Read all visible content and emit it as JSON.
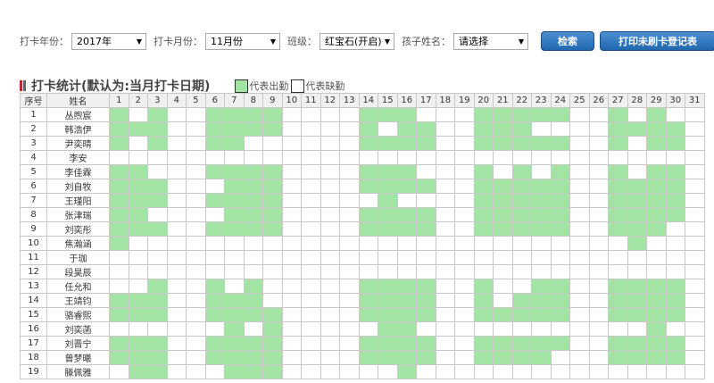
{
  "filters": {
    "year_label": "打卡年份：",
    "year_value": "2017年",
    "month_label": "打卡月份：",
    "month_value": "11月份",
    "class_label": "班级：",
    "class_value": "红宝石(开启)",
    "child_label": "孩子姓名：",
    "child_value": "请选择",
    "search_button": "检索",
    "print_button": "打印未刷卡登记表"
  },
  "section": {
    "title": "打卡统计(默认为:当月打卡日期)",
    "legend_present": "代表出勤",
    "legend_absent": "代表缺勤"
  },
  "colors": {
    "present": "#a3e4a5",
    "button": "#2a6fb5"
  },
  "table": {
    "header_index": "序号",
    "header_name": "姓名",
    "days": [
      "1",
      "2",
      "3",
      "4",
      "5",
      "6",
      "7",
      "8",
      "9",
      "10",
      "11",
      "12",
      "13",
      "14",
      "15",
      "16",
      "17",
      "18",
      "19",
      "20",
      "21",
      "22",
      "23",
      "24",
      "25",
      "26",
      "27",
      "28",
      "29",
      "30",
      "31"
    ],
    "rows": [
      {
        "index": "1",
        "name": "丛煦宸",
        "present": [
          1,
          3,
          6,
          7,
          8,
          9,
          14,
          15,
          16,
          20,
          21,
          22,
          23,
          24,
          27,
          29
        ]
      },
      {
        "index": "2",
        "name": "韩浩伊",
        "present": [
          1,
          2,
          3,
          6,
          7,
          8,
          9,
          14,
          16,
          17,
          20,
          21,
          22,
          27,
          28,
          29,
          30
        ]
      },
      {
        "index": "3",
        "name": "尹奕晴",
        "present": [
          1,
          3,
          6,
          7,
          14,
          15,
          16,
          17,
          20,
          21,
          22,
          23,
          24,
          27,
          29,
          30
        ]
      },
      {
        "index": "4",
        "name": "李安",
        "present": []
      },
      {
        "index": "5",
        "name": "李佳霖",
        "present": [
          1,
          2,
          6,
          7,
          8,
          9,
          14,
          15,
          16,
          20,
          22,
          24,
          27,
          29,
          30
        ]
      },
      {
        "index": "6",
        "name": "刘自牧",
        "present": [
          1,
          2,
          3,
          7,
          8,
          9,
          14,
          15,
          16,
          17,
          20,
          21,
          22,
          23,
          24,
          27,
          28,
          29,
          30
        ]
      },
      {
        "index": "7",
        "name": "王瑾阳",
        "present": [
          1,
          2,
          3,
          6,
          7,
          8,
          9,
          15,
          20,
          21,
          22,
          23,
          24,
          27,
          28,
          29,
          30
        ]
      },
      {
        "index": "8",
        "name": "张津瑞",
        "present": [
          1,
          2,
          7,
          8,
          9,
          14,
          15,
          16,
          17,
          20,
          21,
          22,
          23,
          24,
          27,
          28,
          29,
          30
        ]
      },
      {
        "index": "9",
        "name": "刘奕彤",
        "present": [
          1,
          2,
          3,
          6,
          7,
          8,
          9,
          14,
          15,
          16,
          17,
          20,
          21,
          22,
          23,
          24,
          27,
          28,
          29
        ]
      },
      {
        "index": "10",
        "name": "焦瀚涵",
        "present": [
          1,
          28
        ]
      },
      {
        "index": "11",
        "name": "于珈",
        "present": []
      },
      {
        "index": "12",
        "name": "段昊辰",
        "present": []
      },
      {
        "index": "13",
        "name": "任允和",
        "present": [
          3,
          6,
          8,
          14,
          15,
          16,
          17,
          20,
          23,
          24,
          27,
          28,
          29,
          30
        ]
      },
      {
        "index": "14",
        "name": "王靖钧",
        "present": [
          1,
          2,
          3,
          6,
          7,
          8,
          14,
          15,
          16,
          17,
          20,
          22,
          23,
          24,
          27,
          28,
          29,
          30
        ]
      },
      {
        "index": "15",
        "name": "骆睿熙",
        "present": [
          1,
          2,
          3,
          6,
          7,
          8,
          9,
          14,
          15,
          16,
          17,
          20,
          21,
          22,
          23,
          24,
          27,
          28,
          29,
          30
        ]
      },
      {
        "index": "16",
        "name": "刘奕菡",
        "present": [
          7,
          9,
          15,
          16,
          29
        ]
      },
      {
        "index": "17",
        "name": "刘晋宁",
        "present": [
          1,
          2,
          3,
          6,
          7,
          8,
          9,
          14,
          15,
          16,
          17,
          20,
          21,
          22,
          23,
          24,
          27,
          28,
          29,
          30
        ]
      },
      {
        "index": "18",
        "name": "曾梦曦",
        "present": [
          1,
          2,
          3,
          6,
          7,
          8,
          9,
          14,
          15,
          16,
          17,
          20,
          21,
          22,
          23,
          27,
          28,
          29,
          30
        ]
      },
      {
        "index": "19",
        "name": "滕佩雅",
        "present": [
          2,
          3,
          7,
          8,
          9,
          16
        ]
      }
    ]
  }
}
